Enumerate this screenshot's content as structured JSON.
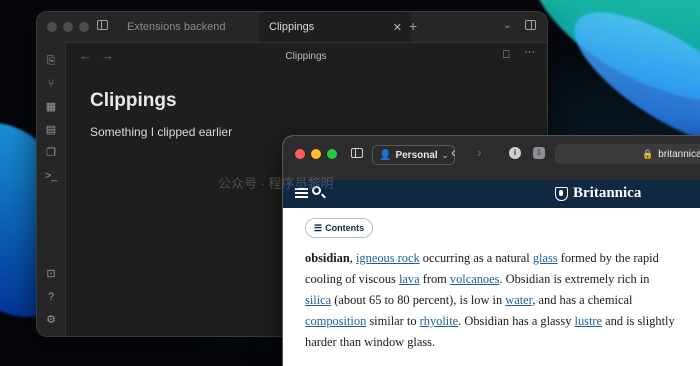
{
  "obsidian": {
    "tabs": [
      {
        "label": "Extensions backend",
        "active": false
      },
      {
        "label": "Clippings",
        "active": true
      }
    ],
    "header_title": "Clippings",
    "note": {
      "title": "Clippings",
      "body": "Something I clipped earlier"
    }
  },
  "safari": {
    "profile_label": "Personal",
    "url": "britannica",
    "site_logo": "Britannica",
    "contents_label": "Contents",
    "article": {
      "term": "obsidian",
      "segments": [
        {
          "text": ", ",
          "link": false
        },
        {
          "text": "igneous rock",
          "link": true
        },
        {
          "text": " occurring as a natural ",
          "link": false
        },
        {
          "text": "glass",
          "link": true
        },
        {
          "text": " formed by the rapid cooling of viscous ",
          "link": false
        },
        {
          "text": "lava",
          "link": true
        },
        {
          "text": " from ",
          "link": false
        },
        {
          "text": "volcanoes",
          "link": true
        },
        {
          "text": ". Obsidian is extremely rich in ",
          "link": false
        },
        {
          "text": "silica",
          "link": true
        },
        {
          "text": " (about 65 to 80 percent), is low in ",
          "link": false
        },
        {
          "text": "water",
          "link": true
        },
        {
          "text": ", and has a chemical ",
          "link": false
        },
        {
          "text": "composition",
          "link": true
        },
        {
          "text": " similar to ",
          "link": false
        },
        {
          "text": "rhyolite",
          "link": true
        },
        {
          "text": ". Obsidian has a glassy ",
          "link": false
        },
        {
          "text": "lustre",
          "link": true
        },
        {
          "text": " and is slightly harder than window glass.",
          "link": false
        }
      ]
    }
  },
  "watermark": "公众号 · 程序员黎明",
  "colors": {
    "obsidian_bg": "#1e1e1e",
    "britannica_navy": "#0f2942",
    "link_blue": "#1f5f99",
    "traffic_red": "#fe5f57",
    "traffic_yellow": "#febc2e",
    "traffic_green": "#28c840"
  }
}
